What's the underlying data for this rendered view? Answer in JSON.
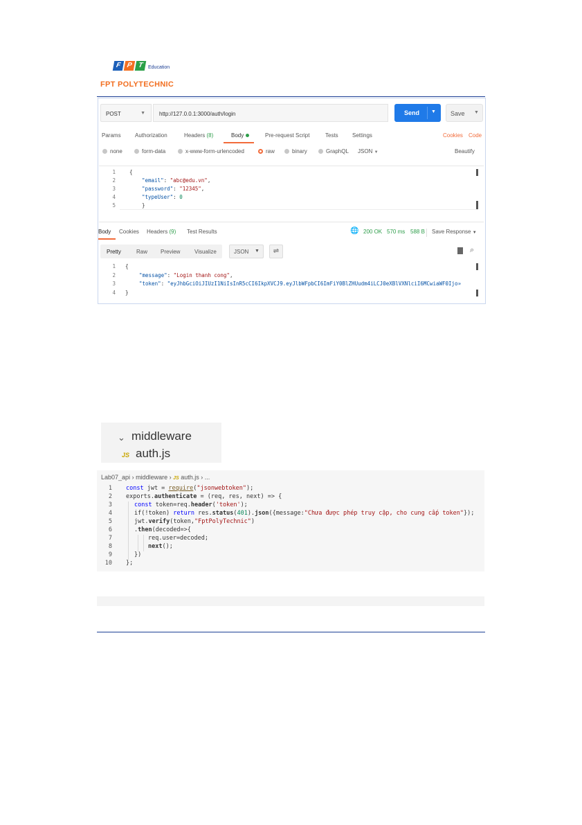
{
  "logo": {
    "tiles": [
      "F",
      "P",
      "T"
    ],
    "edu": "Education",
    "name": "FPT POLYTECHNIC"
  },
  "postman": {
    "method": "POST",
    "url": "http://127.0.0.1:3000/auth/login",
    "send_label": "Send",
    "save_label": "Save",
    "tabs": {
      "params": "Params",
      "authorization": "Authorization",
      "headers": "Headers",
      "headers_count": "(8)",
      "body": "Body",
      "prerequest": "Pre-request Script",
      "tests": "Tests",
      "settings": "Settings",
      "cookies": "Cookies",
      "code": "Code"
    },
    "body_types": {
      "none": "none",
      "form_data": "form-data",
      "urlencoded": "x-www-form-urlencoded",
      "raw": "raw",
      "binary": "binary",
      "graphql": "GraphQL",
      "json": "JSON",
      "beautify": "Beautify"
    },
    "request_lines": [
      "1",
      "2",
      "3",
      "4",
      "5"
    ],
    "request_body": {
      "open": "{",
      "email_key": "\"email\"",
      "email_val": "\"abc@edu.vn\"",
      "password_key": "\"password\"",
      "password_val": "\"12345\"",
      "typeuser_key": "\"typeUser\"",
      "typeuser_val": "0",
      "close": "}"
    },
    "response_tabs": {
      "body": "Body",
      "cookies": "Cookies",
      "headers": "Headers",
      "headers_count": "(9)",
      "test_results": "Test Results",
      "status": "200 OK",
      "time": "570 ms",
      "size": "588 B",
      "save_response": "Save Response"
    },
    "response_tools": {
      "pretty": "Pretty",
      "raw": "Raw",
      "preview": "Preview",
      "visualize": "Visualize",
      "format": "JSON"
    },
    "response_lines": [
      "1",
      "2",
      "3",
      "4"
    ],
    "response_body": {
      "open": "{",
      "message_key": "\"message\"",
      "message_val": "\"Login thanh cong\"",
      "token_key": "\"token\"",
      "token_val": "\"eyJhbGciOiJIUzI1NiIsInR5cCI6IkpXVCJ9.eyJlbWFpbCI6ImFiY0BlZHUudm4iLCJ0eXBlVXNlciI6MCwiaWF0Ijo»",
      "close": "}"
    }
  },
  "explorer": {
    "folder": "middleware",
    "file_icon": "JS",
    "file": "auth.js"
  },
  "vscode": {
    "breadcrumb": {
      "root": "Lab07_api",
      "folder": "middleware",
      "file_icon": "JS",
      "file": "auth.js",
      "more": "..."
    },
    "line_numbers": [
      "1",
      "2",
      "3",
      "4",
      "5",
      "6",
      "7",
      "8",
      "9",
      "10"
    ],
    "code": {
      "l1_const": "const",
      "l1_rest": " jwt = ",
      "l1_fn": "require",
      "l1_str": "\"jsonwebtoken\"",
      "l1_end": ");",
      "l2_a": "exports.",
      "l2_fn": "authenticate",
      "l2_rest": " = (req, res, next) => {",
      "l3_const": "const",
      "l3_a": " token=req.",
      "l3_fn": "header",
      "l3_str": "'token'",
      "l3_end": ");",
      "l4_a": "if(!token) ",
      "l4_ret": "return",
      "l4_b": " res.",
      "l4_status": "status",
      "l4_num": "401",
      "l4_c": ").",
      "l4_json": "json",
      "l4_d": "({message:",
      "l4_str": "\"Chưa được phép truy cập, cho cung cấp token\"",
      "l4_end": "});",
      "l5_a": "jwt.",
      "l5_fn": "verify",
      "l5_b": "(token,",
      "l5_str": "\"FptPolyTechnic\"",
      "l5_end": ")",
      "l6_a": ".",
      "l6_fn": "then",
      "l6_b": "(decoded=>{",
      "l7": "req.user=decoded;",
      "l8_fn": "next",
      "l8_end": "();",
      "l9": "})",
      "l10": "};"
    }
  },
  "colors": {
    "brand_blue": "#1c3f94",
    "brand_orange": "#f26f21",
    "send_blue": "#1f7ae8",
    "status_green": "#2d9d4a",
    "accent_orange": "#f26b3a"
  }
}
